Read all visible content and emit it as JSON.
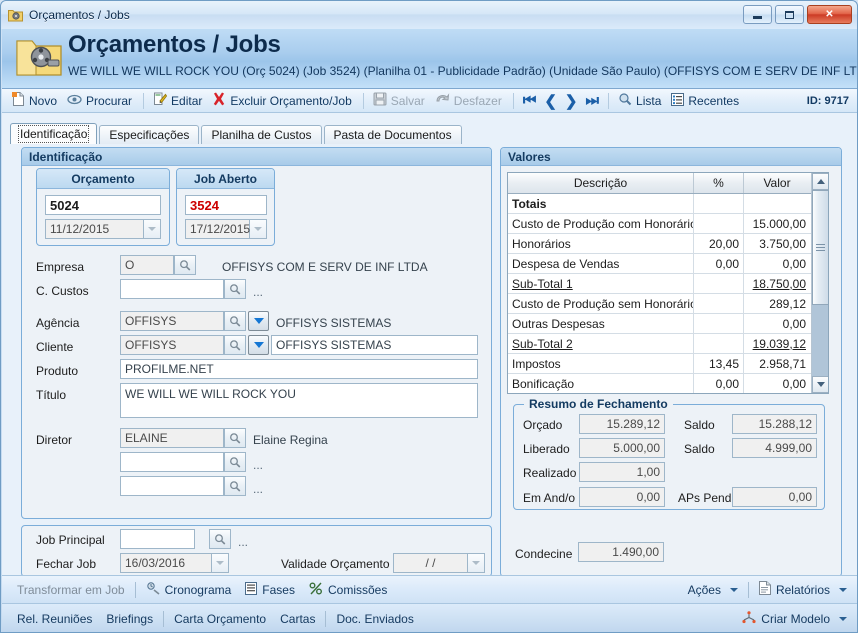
{
  "window": {
    "title": "Orçamentos / Jobs",
    "icon": "film-folder-icon",
    "buttons": {
      "minimize": "minimize-icon",
      "maximize": "maximize-icon",
      "close": "✕"
    }
  },
  "banner": {
    "title": "Orçamentos / Jobs",
    "subtitle": "WE WILL WE WILL ROCK YOU (Orç 5024) (Job 3524)  (Planilha 01 - Publicidade Padrão) (Unidade São Paulo) (OFFISYS COM E SERV DE INF LTDA)"
  },
  "toolbar": {
    "novo": "Novo",
    "procurar": "Procurar",
    "editar": "Editar",
    "excluir": "Excluir Orçamento/Job",
    "salvar": "Salvar",
    "desfazer": "Desfazer",
    "nav_first": "⏮",
    "nav_prev": "❮",
    "nav_next": "❯",
    "nav_last": "⏭",
    "lista": "Lista",
    "recentes": "Recentes",
    "id": "ID: 9717"
  },
  "tabs": [
    {
      "label": "Identificação",
      "active": true
    },
    {
      "label": "Especificações",
      "active": false
    },
    {
      "label": "Planilha de Custos",
      "active": false
    },
    {
      "label": "Pasta de Documentos",
      "active": false
    }
  ],
  "identificacao": {
    "group_title": "Identificação",
    "orcamento": {
      "card_title": "Orçamento",
      "number": "5024",
      "date": "11/12/2015"
    },
    "job_aberto": {
      "card_title": "Job Aberto",
      "number": "3524",
      "date": "17/12/2015"
    },
    "fields": {
      "empresa_label": "Empresa",
      "empresa_value": "O",
      "empresa_desc": "OFFISYS COM E SERV DE INF LTDA",
      "ccustos_label": "C. Custos",
      "ccustos_value": "",
      "ccustos_desc": "...",
      "agencia_label": "Agência",
      "agencia_value": "OFFISYS",
      "agencia_desc": "OFFISYS SISTEMAS",
      "cliente_label": "Cliente",
      "cliente_value": "OFFISYS",
      "cliente_desc": "OFFISYS SISTEMAS",
      "produto_label": "Produto",
      "produto_value": "PROFILME.NET",
      "titulo_label": "Título",
      "titulo_value": "WE WILL WE WILL ROCK YOU",
      "diretor_label": "Diretor",
      "diretor_value": "ELAINE",
      "diretor_desc": "Elaine Regina",
      "extra1_value": "",
      "extra1_desc": "...",
      "extra2_value": "",
      "extra2_desc": "..."
    },
    "job": {
      "job_principal_label": "Job Principal",
      "job_principal_value": "",
      "job_principal_desc": "...",
      "fechar_job_label": "Fechar Job",
      "fechar_job_value": "16/03/2016",
      "validade_label": "Validade Orçamento",
      "validade_value": "/  /"
    }
  },
  "valores": {
    "group_title": "Valores",
    "columns": [
      "Descrição",
      "%",
      "Valor"
    ],
    "rows": [
      {
        "desc": "Totais",
        "pct": "",
        "val": "",
        "style": "bold"
      },
      {
        "desc": "Custo de Produção com Honorários",
        "pct": "",
        "val": "15.000,00",
        "style": ""
      },
      {
        "desc": "Honorários",
        "pct": "20,00",
        "val": "3.750,00",
        "style": ""
      },
      {
        "desc": "Despesa de Vendas",
        "pct": "0,00",
        "val": "0,00",
        "style": ""
      },
      {
        "desc": "Sub-Total 1",
        "pct": "",
        "val": "18.750,00",
        "style": "subtotal"
      },
      {
        "desc": "Custo de Produção sem Honorários",
        "pct": "",
        "val": "289,12",
        "style": ""
      },
      {
        "desc": "Outras Despesas",
        "pct": "",
        "val": "0,00",
        "style": ""
      },
      {
        "desc": "Sub-Total 2",
        "pct": "",
        "val": "19.039,12",
        "style": "subtotal"
      },
      {
        "desc": "Impostos",
        "pct": "13,45",
        "val": "2.958,71",
        "style": ""
      },
      {
        "desc": "Bonificação",
        "pct": "0,00",
        "val": "0,00",
        "style": ""
      }
    ]
  },
  "resumo": {
    "legend": "Resumo de Fechamento",
    "orcado_label": "Orçado",
    "orcado_value": "15.289,12",
    "saldo1_label": "Saldo",
    "saldo1_value": "15.288,12",
    "liberado_label": "Liberado",
    "liberado_value": "5.000,00",
    "saldo2_label": "Saldo",
    "saldo2_value": "4.999,00",
    "realizado_label": "Realizado",
    "realizado_value": "1,00",
    "emando_label": "Em And/o",
    "emando_value": "0,00",
    "aps_label": "APs Pend.",
    "aps_value": "0,00",
    "condecine_label": "Condecine",
    "condecine_value": "1.490,00"
  },
  "footer1": {
    "transformar": "Transformar em Job",
    "cronograma": "Cronograma",
    "fases": "Fases",
    "comissoes": "Comissões",
    "acoes": "Ações",
    "relatorios": "Relatórios"
  },
  "footer2": {
    "rel_reunioes": "Rel. Reuniões",
    "briefings": "Briefings",
    "carta_orcamento": "Carta Orçamento",
    "cartas": "Cartas",
    "doc_enviados": "Doc. Enviados",
    "criar_modelo": "Criar Modelo"
  },
  "colors": {
    "accent": "#1577d4",
    "banner_text": "#0d2b4c",
    "red_value": "#cc0000",
    "close_button": "#cc3b25"
  }
}
